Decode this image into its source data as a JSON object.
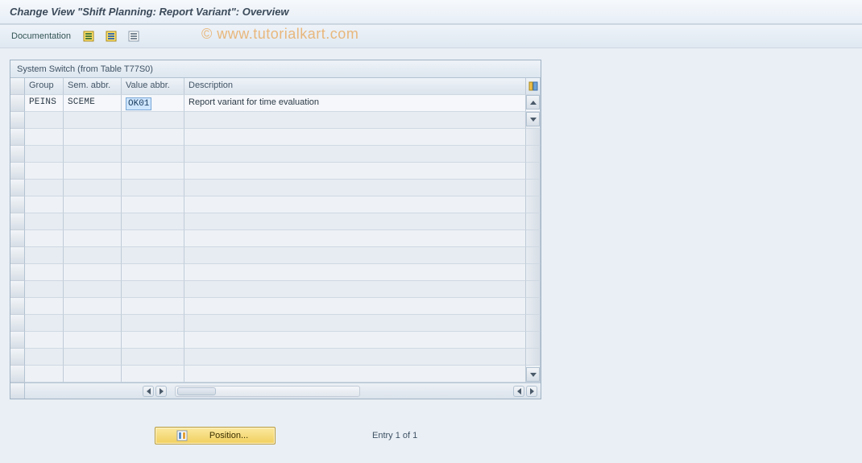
{
  "title": "Change View \"Shift Planning: Report Variant\": Overview",
  "toolbar": {
    "documentation_label": "Documentation",
    "icons": [
      "doc-select-icon",
      "doc-save-icon",
      "doc-list-icon"
    ]
  },
  "watermark": "© www.tutorialkart.com",
  "panel": {
    "title": "System Switch (from Table T77S0)",
    "columns": {
      "group": "Group",
      "sem": "Sem. abbr.",
      "val": "Value abbr.",
      "desc": "Description"
    },
    "rows": [
      {
        "group": "PEINS",
        "sem": "SCEME",
        "val": "OK01",
        "desc": "Report variant for time evaluation"
      }
    ],
    "empty_row_count": 16
  },
  "footer": {
    "position_label": "Position...",
    "entry_status": "Entry 1 of 1"
  }
}
